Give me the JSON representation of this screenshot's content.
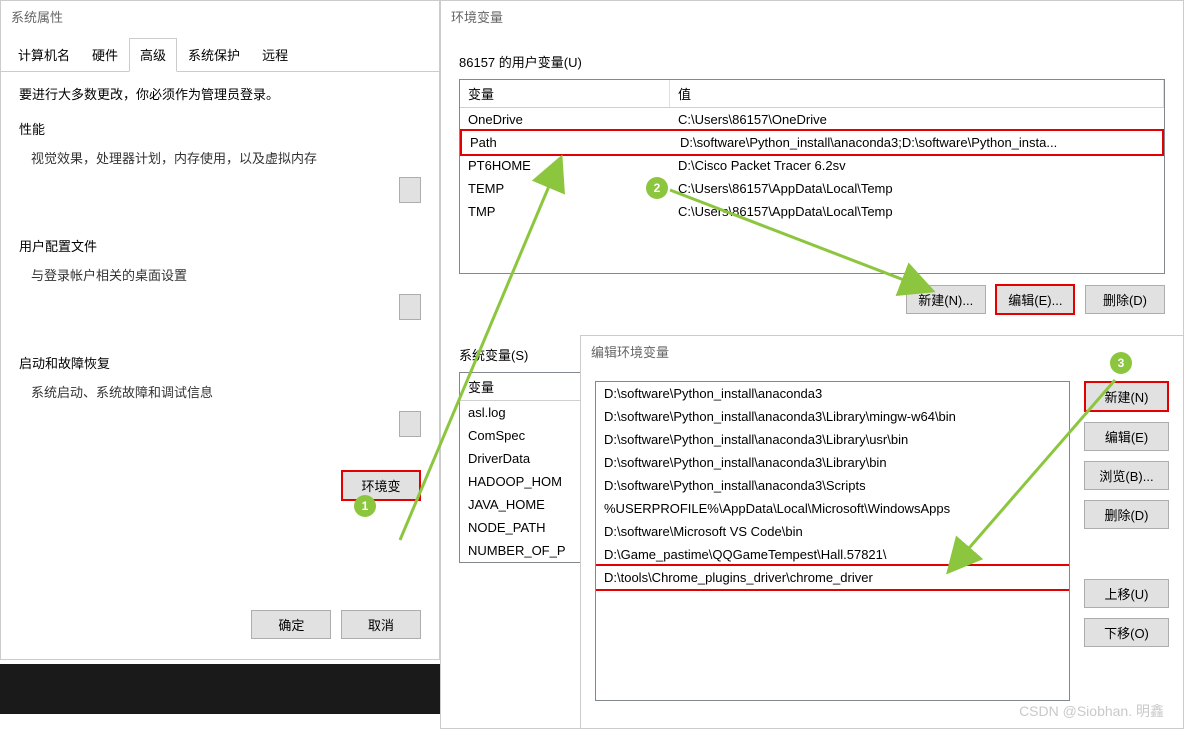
{
  "sysprops": {
    "title": "系统属性",
    "tabs": [
      "计算机名",
      "硬件",
      "高级",
      "系统保护",
      "远程"
    ],
    "active_tab": 2,
    "intro": "要进行大多数更改，你必须作为管理员登录。",
    "perf_title": "性能",
    "perf_desc": "视觉效果，处理器计划，内存使用，以及虚拟内存",
    "profile_title": "用户配置文件",
    "profile_desc": "与登录帐户相关的桌面设置",
    "startup_title": "启动和故障恢复",
    "startup_desc": "系统启动、系统故障和调试信息",
    "env_btn": "环境变",
    "ok": "确定",
    "cancel": "取消"
  },
  "envvars": {
    "title": "环境变量",
    "user_group": "86157 的用户变量(U)",
    "sys_group": "系统变量(S)",
    "col_var": "变量",
    "col_val": "值",
    "user_rows": [
      {
        "k": "OneDrive",
        "v": "C:\\Users\\86157\\OneDrive"
      },
      {
        "k": "Path",
        "v": "D:\\software\\Python_install\\anaconda3;D:\\software\\Python_insta..."
      },
      {
        "k": "PT6HOME",
        "v": "D:\\Cisco Packet Tracer 6.2sv"
      },
      {
        "k": "TEMP",
        "v": "C:\\Users\\86157\\AppData\\Local\\Temp"
      },
      {
        "k": "TMP",
        "v": "C:\\Users\\86157\\AppData\\Local\\Temp"
      }
    ],
    "sys_rows": [
      {
        "k": "asl.log"
      },
      {
        "k": "ComSpec"
      },
      {
        "k": "DriverData"
      },
      {
        "k": "HADOOP_HOM"
      },
      {
        "k": "JAVA_HOME"
      },
      {
        "k": "NODE_PATH"
      },
      {
        "k": "NUMBER_OF_P"
      }
    ],
    "new_btn": "新建(N)...",
    "edit_btn": "编辑(E)...",
    "del_btn": "删除(D)"
  },
  "editenv": {
    "title": "编辑环境变量",
    "paths": [
      "D:\\software\\Python_install\\anaconda3",
      "D:\\software\\Python_install\\anaconda3\\Library\\mingw-w64\\bin",
      "D:\\software\\Python_install\\anaconda3\\Library\\usr\\bin",
      "D:\\software\\Python_install\\anaconda3\\Library\\bin",
      "D:\\software\\Python_install\\anaconda3\\Scripts",
      "%USERPROFILE%\\AppData\\Local\\Microsoft\\WindowsApps",
      "D:\\software\\Microsoft VS Code\\bin",
      "D:\\Game_pastime\\QQGameTempest\\Hall.57821\\",
      "D:\\tools\\Chrome_plugins_driver\\chrome_driver"
    ],
    "new_btn": "新建(N)",
    "edit_btn": "编辑(E)",
    "browse_btn": "浏览(B)...",
    "del_btn": "删除(D)",
    "up_btn": "上移(U)",
    "down_btn": "下移(O)"
  },
  "markers": {
    "m1": "1",
    "m2": "2",
    "m3": "3"
  },
  "watermark": "CSDN @Siobhan. 明鑫"
}
